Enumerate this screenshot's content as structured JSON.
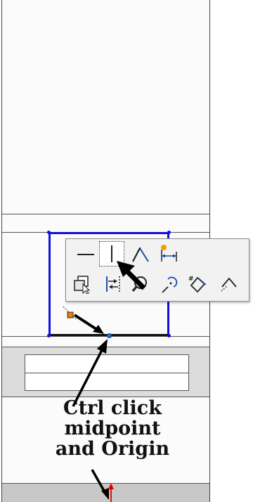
{
  "annotation": {
    "line1": "Ctrl click",
    "line2": "midpoint",
    "line3": "and Origin"
  },
  "context_toolbar": {
    "row1": [
      {
        "icon": "horizontal-relation-icon"
      },
      {
        "icon": "vertical-relation-icon",
        "selected": true
      },
      {
        "icon": "angle-dimension-icon"
      },
      {
        "icon": "smart-dimension-icon"
      }
    ],
    "row2": [
      {
        "icon": "copy-entities-icon"
      },
      {
        "icon": "mirror-entities-icon"
      },
      {
        "icon": "zoom-to-selection-icon"
      },
      {
        "icon": "offset-entities-icon"
      },
      {
        "icon": "sketch-numbers-icon"
      },
      {
        "icon": "construction-geometry-icon"
      }
    ]
  },
  "colors": {
    "sketch_blue": "#1010e0",
    "selected_edge": "#111111",
    "origin_red": "#e00000",
    "inference_orange": "#f07800",
    "annotation_text": "#111111"
  }
}
